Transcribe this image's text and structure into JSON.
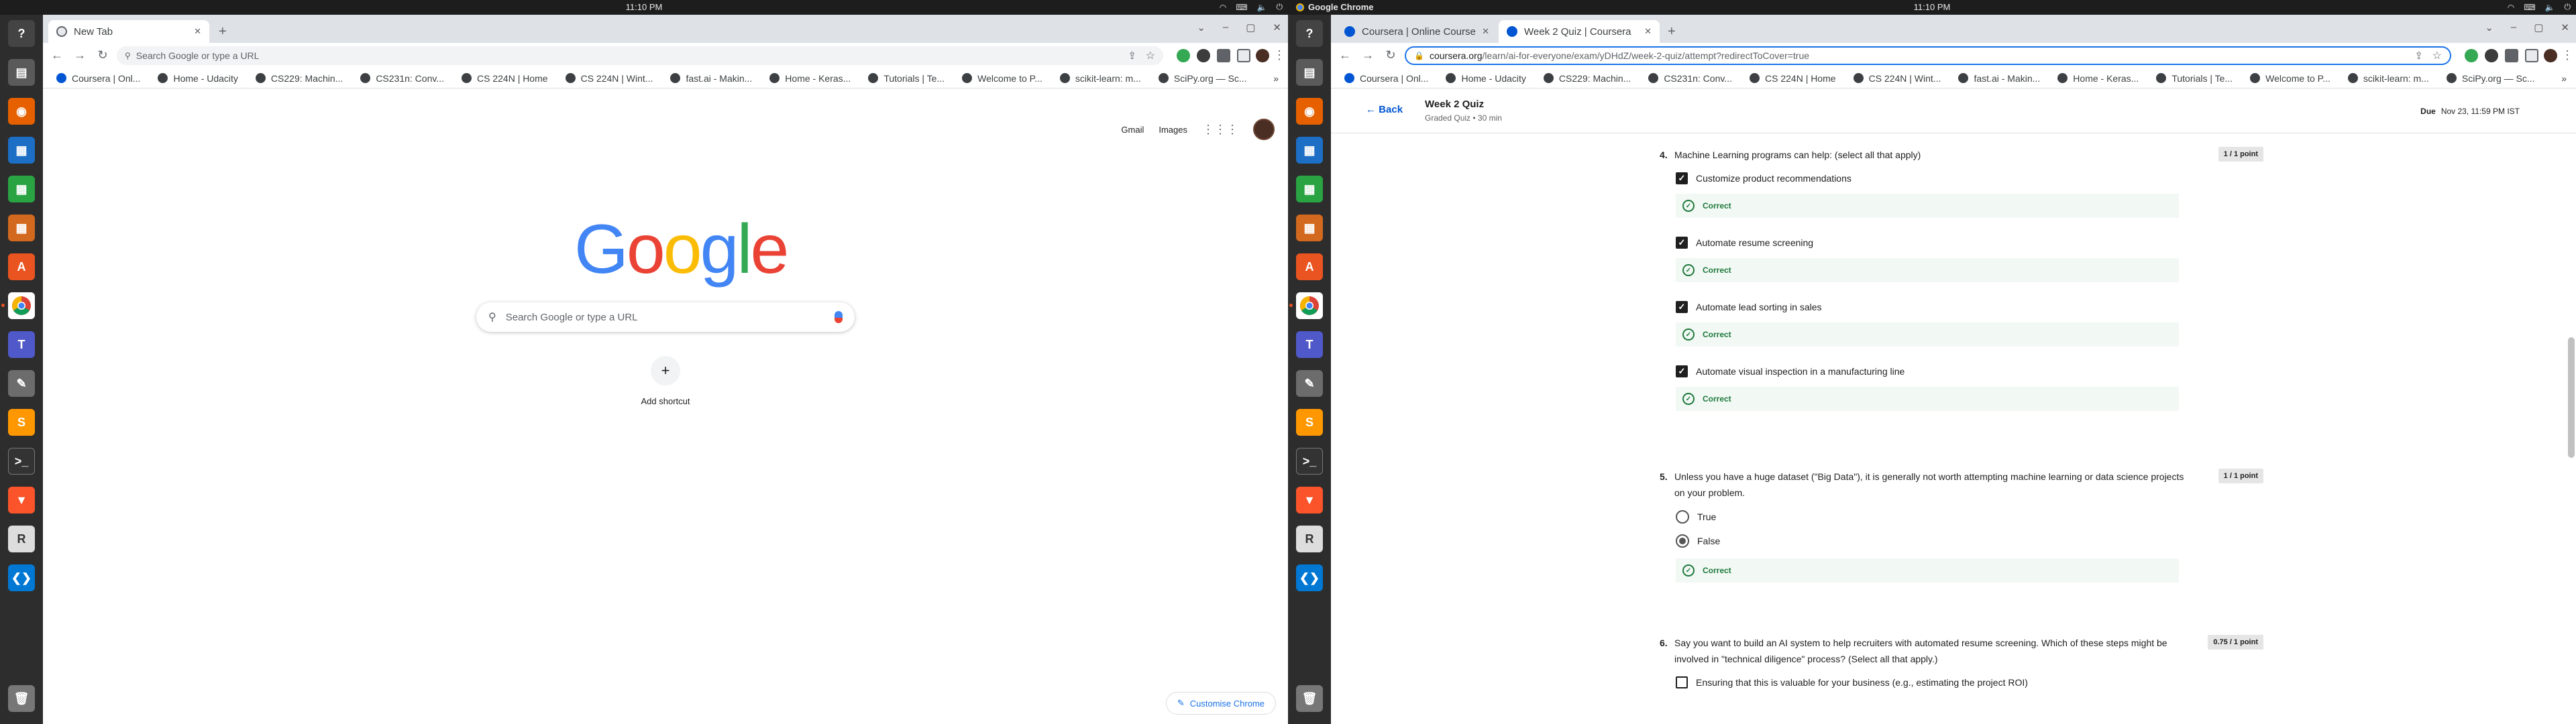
{
  "system": {
    "left_clock": "11:10 PM",
    "right_clock": "11:10 PM",
    "right_app_name": "Google Chrome",
    "left_time": "11:10 PM",
    "right_time": "11:10 PM"
  },
  "dock": {
    "items": [
      "help",
      "files",
      "firefox",
      "writer",
      "calc",
      "impress",
      "software",
      "chrome",
      "teams",
      "text-editor",
      "sublime",
      "terminal",
      "brave",
      "rstudio",
      "vscode",
      "trash"
    ]
  },
  "left_window": {
    "tab": {
      "label": "New Tab"
    },
    "omnibox": {
      "placeholder": "Search Google or type a URL"
    },
    "bookmarks": [
      "Coursera | Onl...",
      "Home - Udacity",
      "CS229: Machin...",
      "CS231n: Conv...",
      "CS 224N | Home",
      "CS 224N | Wint...",
      "fast.ai - Makin...",
      "Home - Keras...",
      "Tutorials | Te...",
      "Welcome to P...",
      "scikit-learn: m...",
      "SciPy.org — Sc..."
    ],
    "google": {
      "gmail": "Gmail",
      "images": "Images",
      "logo": "Google",
      "search_placeholder": "Search Google or type a URL",
      "add_shortcut": "Add shortcut",
      "customise": "Customise Chrome"
    }
  },
  "right_window": {
    "tabs": [
      {
        "label": "Coursera | Online Courses"
      },
      {
        "label": "Week 2 Quiz | Coursera"
      }
    ],
    "url": {
      "host": "coursera.org",
      "path": "/learn/ai-for-everyone/exam/yDHdZ/week-2-quiz/attempt?redirectToCover=true"
    },
    "bookmarks": [
      "Coursera | Onl...",
      "Home - Udacity",
      "CS229: Machin...",
      "CS231n: Conv...",
      "CS 224N | Home",
      "CS 224N | Wint...",
      "fast.ai - Makin...",
      "Home - Keras...",
      "Tutorials | Te...",
      "Welcome to P...",
      "scikit-learn: m...",
      "SciPy.org — Sc..."
    ],
    "header": {
      "back": "Back",
      "title": "Week 2 Quiz",
      "subtitle": "Graded Quiz • 30 min",
      "due_label": "Due",
      "due_value": "Nov 23, 11:59 PM IST"
    },
    "q4": {
      "number": "4.",
      "text": "Machine Learning programs can help: (select all that apply)",
      "points": "1 / 1 point",
      "options": [
        "Customize product recommendations",
        "Automate resume screening",
        "Automate lead sorting in sales",
        "Automate visual inspection in a manufacturing line"
      ],
      "feedback": "Correct"
    },
    "q5": {
      "number": "5.",
      "text": "Unless you have a huge dataset (\"Big Data\"), it is generally not worth attempting machine learning or data science projects on your problem.",
      "points": "1 / 1 point",
      "options": [
        "True",
        "False"
      ],
      "selected": "False",
      "feedback": "Correct"
    },
    "q6": {
      "number": "6.",
      "text": "Say you want to build an AI system to help recruiters with automated resume screening. Which of these steps might be involved in \"technical diligence\" process?  (Select all that apply.)",
      "points": "0.75 / 1 point",
      "option_1": "Ensuring that this is valuable for your business (e.g., estimating the project ROI)"
    }
  },
  "colors": {
    "accent_blue": "#1a73e8",
    "coursera_blue": "#0056d2",
    "correct_green": "#1e7a3c",
    "ubuntu_orange": "#e95420"
  }
}
